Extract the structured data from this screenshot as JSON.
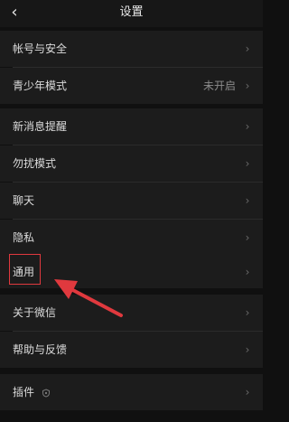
{
  "header": {
    "title": "设置"
  },
  "items": [
    {
      "label": "帐号与安全",
      "value": ""
    },
    {
      "label": "青少年模式",
      "value": "未开启"
    },
    {
      "label": "新消息提醒",
      "value": ""
    },
    {
      "label": "勿扰模式",
      "value": ""
    },
    {
      "label": "聊天",
      "value": ""
    },
    {
      "label": "隐私",
      "value": ""
    },
    {
      "label": "通用",
      "value": ""
    },
    {
      "label": "关于微信",
      "value": ""
    },
    {
      "label": "帮助与反馈",
      "value": ""
    },
    {
      "label": "插件",
      "value": ""
    }
  ],
  "icons": {
    "back": "chevron-left-icon",
    "row_chevron": "chevron-right-icon",
    "plugin": "plugin-indicator-icon",
    "annotation": "red-arrow-icon"
  },
  "colors": {
    "background": "#101010",
    "row": "#1c1c1c",
    "annotation": "#e0393e"
  }
}
